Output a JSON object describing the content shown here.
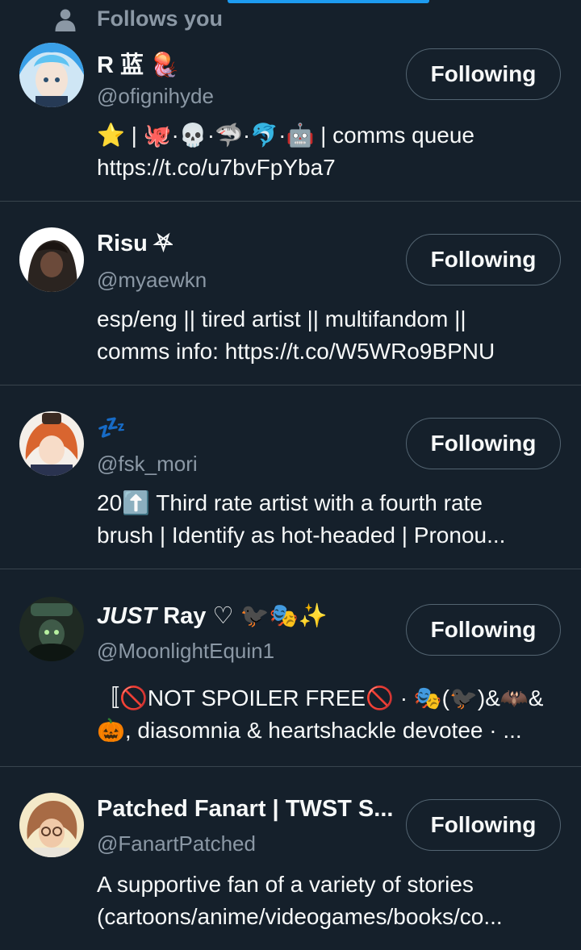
{
  "tab_indicator_color": "#1d9bf0",
  "colors": {
    "background": "#15202b",
    "text_primary": "#f7f9f9",
    "text_secondary": "#8b98a5",
    "divider": "#38444d",
    "button_border": "#536471"
  },
  "follow_button_label": "Following",
  "users": [
    {
      "social_context": "Follows you",
      "display_name": "R 蓝 🪼",
      "handle": "@ofignihyde",
      "bio_lines": [
        "⭐ | 🐙·💀·🦈·🐬·🤖 | comms queue",
        "https://t.co/u7bvFpYba7"
      ],
      "button_label": "Following"
    },
    {
      "display_name": "Risu ⛧",
      "handle": "@myaewkn",
      "bio_lines": [
        "esp/eng || tired artist || multifandom ||",
        "comms info: https://t.co/W5WRo9BPNU"
      ],
      "button_label": "Following"
    },
    {
      "display_name": "💤",
      "handle": "@fsk_mori",
      "bio_lines": [
        "20⬆️ Third rate artist with a fourth rate",
        "brush | Identify as hot-headed | Pronou..."
      ],
      "button_label": "Following"
    },
    {
      "display_name_italic": "JUST",
      "display_name": "Ray ♡ 🐦‍⬛🎭✨",
      "handle": "@MoonlightEquin1",
      "bio_lines": [
        "〚🚫NOT SPOILER FREE🚫 · 🎭(🐦‍⬛)&🦇&",
        "🎃, diasomnia & heartshackle devotee · ..."
      ],
      "button_label": "Following"
    },
    {
      "display_name": "Patched Fanart | TWST S...",
      "handle": "@FanartPatched",
      "bio_lines": [
        "A supportive fan of a variety of stories",
        "(cartoons/anime/videogames/books/co..."
      ],
      "button_label": "Following"
    }
  ]
}
